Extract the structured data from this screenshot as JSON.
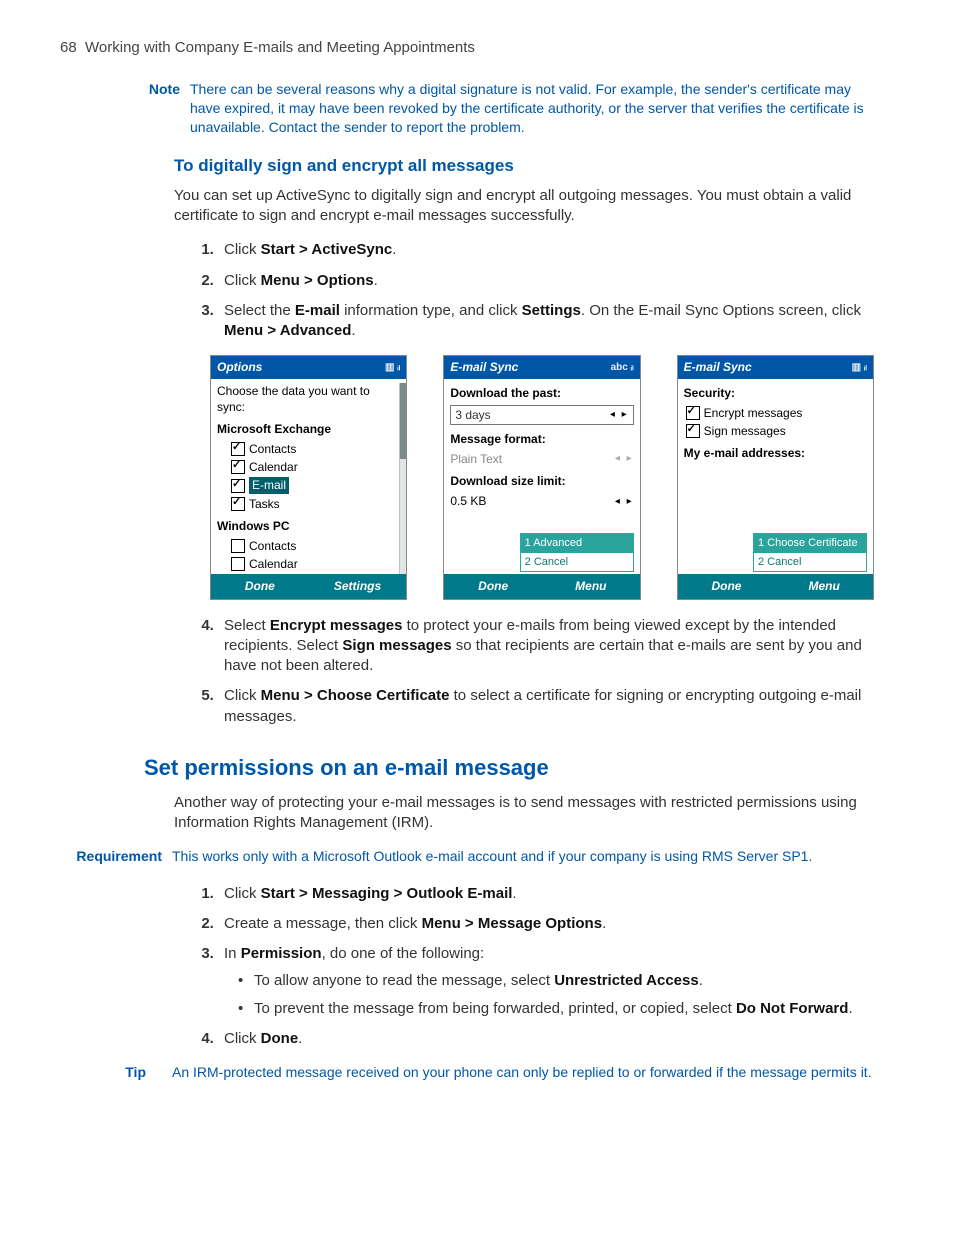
{
  "header": {
    "page_number": "68",
    "chapter": "Working with Company E-mails and Meeting Appointments"
  },
  "note1": {
    "label": "Note",
    "text": "There can be several reasons why a digital signature is not valid. For example, the sender's certificate may have expired, it may have been revoked by the certificate authority, or the server that verifies the certificate is unavailable. Contact the sender to report the problem."
  },
  "sec1": {
    "heading": "To digitally sign and encrypt all messages",
    "intro": "You can set up ActiveSync to digitally sign and encrypt all outgoing messages. You must obtain a valid certificate to sign and encrypt e-mail messages successfully.",
    "steps": {
      "s1pre": "Click ",
      "s1b": "Start > ActiveSync",
      "s1post": ".",
      "s2pre": "Click ",
      "s2b": "Menu > Options",
      "s2post": ".",
      "s3a": "Select the ",
      "s3b": "E-mail",
      "s3c": " information type, and click ",
      "s3d": "Settings",
      "s3e": ". On the E-mail Sync Options screen, click ",
      "s3f": "Menu > Advanced",
      "s3g": ".",
      "s4a": "Select ",
      "s4b": "Encrypt messages",
      "s4c": " to protect your e-mails from being viewed except by the intended recipients. Select ",
      "s4d": "Sign messages",
      "s4e": " so that recipients are certain that e-mails are sent by you and have not been altered.",
      "s5a": "Click ",
      "s5b": "Menu > Choose Certificate",
      "s5c": " to select a certificate for signing or encrypting outgoing e-mail messages."
    }
  },
  "screens": {
    "s1": {
      "title": "Options",
      "status": "▥ ᵢₗ",
      "prompt": "Choose the data you want to sync:",
      "group1": "Microsoft Exchange",
      "g1_items": [
        "Contacts",
        "Calendar",
        "E-mail",
        "Tasks"
      ],
      "group2": "Windows PC",
      "g2_items": [
        "Contacts",
        "Calendar"
      ],
      "sk_left": "Done",
      "sk_right": "Settings"
    },
    "s2": {
      "title": "E-mail Sync",
      "status": "abc ᵢₗ",
      "lbl1": "Download the past:",
      "val1": "3 days",
      "lbl2": "Message format:",
      "val2": "Plain Text",
      "lbl3": "Download size limit:",
      "val3": "0.5 KB",
      "menu1": "1 Advanced",
      "menu2": "2 Cancel",
      "sk_left": "Done",
      "sk_right": "Menu"
    },
    "s3": {
      "title": "E-mail Sync",
      "status": "▥ ᵢₗ",
      "lbl1": "Security:",
      "opt1": "Encrypt messages",
      "opt2": "Sign messages",
      "lbl2": "My e-mail addresses:",
      "menu1": "1 Choose Certificate",
      "menu2": "2 Cancel",
      "sk_left": "Done",
      "sk_right": "Menu"
    }
  },
  "sec2": {
    "heading": "Set permissions on an e-mail message",
    "intro": "Another way of protecting your e-mail messages is to send messages with restricted permissions using Information Rights Management (IRM).",
    "req_label": "Requirement",
    "req_text": "This works only with a Microsoft Outlook e-mail account and if your company is using RMS Server SP1.",
    "steps": {
      "s1a": "Click ",
      "s1b": "Start > Messaging > Outlook E-mail",
      "s1c": ".",
      "s2a": "Create a message, then click ",
      "s2b": "Menu > Message Options",
      "s2c": ".",
      "s3a": "In ",
      "s3b": "Permission",
      "s3c": ", do one of the following:",
      "b1a": "To allow anyone to read the message, select ",
      "b1b": "Unrestricted Access",
      "b1c": ".",
      "b2a": "To prevent the message from being forwarded, printed, or copied, select ",
      "b2b": "Do Not Forward",
      "b2c": ".",
      "s4a": "Click ",
      "s4b": "Done",
      "s4c": "."
    },
    "tip_label": "Tip",
    "tip_text": "An IRM-protected message received on your phone can only be replied to or forwarded if the message permits it."
  }
}
